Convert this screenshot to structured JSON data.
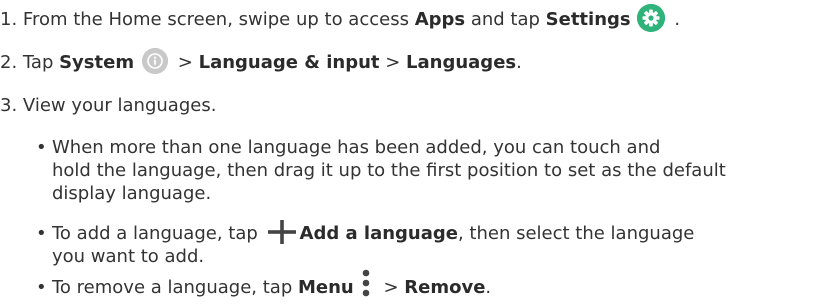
{
  "step1": {
    "prefix": "1. From the Home screen, swipe up to access ",
    "apps": "Apps",
    "mid": " and tap ",
    "settings": "Settings",
    "suffix": " ."
  },
  "step2": {
    "prefix": "2. Tap ",
    "system": "System",
    "sep1": " > ",
    "language_input": "Language & input",
    "sep2": " > ",
    "languages": "Languages",
    "suffix": "."
  },
  "step3": {
    "text": "3. View your languages."
  },
  "bullets": {
    "b1_line1": "When more than one language has been added, you can touch and",
    "b1_line2": "hold the language, then drag it up to the first position to set as the default",
    "b1_line3": "display language.",
    "b2_prefix": "To add a language, tap ",
    "b2_bold": "Add a language",
    "b2_suffix": ", then select the language",
    "b2_line2": "you want to add.",
    "b3_prefix": "To remove a language, tap ",
    "b3_menu": "Menu",
    "b3_sep": " > ",
    "b3_remove": "Remove",
    "b3_suffix": ".",
    "bullet_glyph": "•"
  },
  "colors": {
    "settings_icon": "#2fb37a",
    "system_icon": "#c9c9c9",
    "text": "#333333"
  },
  "icons": {
    "settings": "gear-icon",
    "system": "info-icon",
    "add": "plus-icon",
    "menu": "vertical-dots-menu-icon"
  }
}
